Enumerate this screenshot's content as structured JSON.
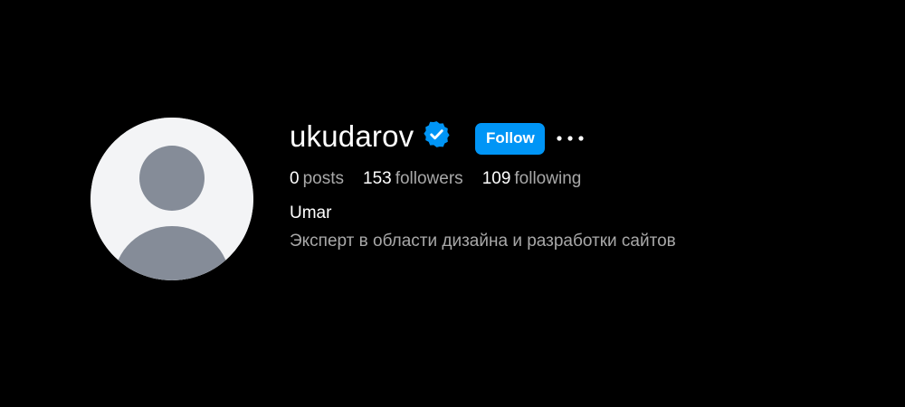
{
  "profile": {
    "username": "ukudarov",
    "verified_icon": "verified-badge-icon",
    "follow_label": "Follow",
    "more_icon": "more-options-icon",
    "full_name": "Umar",
    "bio": "Эксперт в области дизайна и разработки сайтов"
  },
  "stats": {
    "posts_count": "0",
    "posts_label": "posts",
    "followers_count": "153",
    "followers_label": "followers",
    "following_count": "109",
    "following_label": "following"
  },
  "colors": {
    "background": "#000000",
    "accent": "#0095f6",
    "secondary_text": "#a8a8a8",
    "avatar_bg": "#f3f4f6",
    "avatar_fg": "#858c98"
  }
}
